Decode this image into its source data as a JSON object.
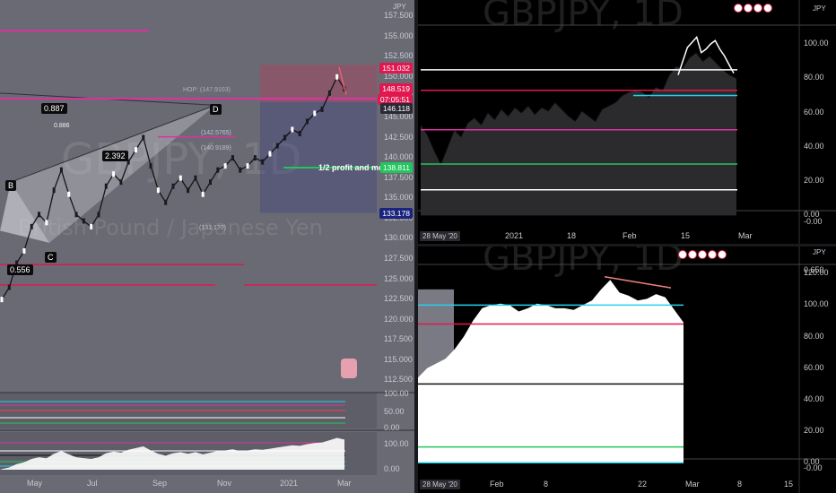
{
  "chart_data": [
    {
      "type": "line",
      "title": "GBPJPY, 1D",
      "subtitle": "British Pound / Japanese Yen",
      "currency_label": "JPY",
      "x_ticks": [
        "May",
        "Jul",
        "Sep",
        "Nov",
        "2021",
        "Mar"
      ],
      "y_ticks": [
        157.5,
        155.0,
        152.5,
        150.0,
        147.5,
        145.0,
        142.5,
        140.0,
        137.5,
        135.0,
        132.5,
        130.0,
        127.5,
        125.0,
        122.5,
        120.0,
        117.5,
        115.0,
        112.5
      ],
      "ylim": [
        111.0,
        159.5
      ],
      "price_tags": [
        {
          "value": 151.032,
          "label": "151.032",
          "color": "#e0184f"
        },
        {
          "value": 148.519,
          "label": "148.519",
          "color": "#e0184f"
        },
        {
          "value": 147.2,
          "label": "07:05:51",
          "color": "#e0184f"
        },
        {
          "value": 146.118,
          "label": "146.118",
          "color": "#2a2a36"
        },
        {
          "value": 138.811,
          "label": "138.811",
          "color": "#22c55e"
        },
        {
          "value": 133.178,
          "label": "133.178",
          "color": "#1a237e"
        }
      ],
      "annotations": {
        "hop": "HOP: (147.9103)",
        "label_0887": "0.887",
        "label_0886": "0.886",
        "label_2392": "2.392",
        "label_0556": "0.556",
        "label_b": "B",
        "label_c": "C",
        "label_d": "D",
        "profit": "1/2 profit and mo",
        "level_1425765": "(142.5765)",
        "level_1409189": "(140.9189)",
        "level_1311": "(131.1??)"
      },
      "series": [
        {
          "values": [
            122.5,
            124.0,
            127.0,
            128.5,
            131.5,
            133.0,
            132.0,
            136.0,
            138.5,
            135.5,
            133.0,
            132.2,
            131.5,
            133.0,
            136.5,
            138.0,
            137.0,
            139.5,
            141.0,
            142.5,
            139.0,
            136.0,
            134.5,
            136.5,
            137.5,
            136.0,
            137.5,
            135.5,
            137.0,
            138.5,
            139.0,
            140.0,
            138.5,
            139.0,
            140.0,
            139.5,
            140.5,
            141.5,
            142.5,
            143.5,
            143.0,
            144.5,
            145.5,
            146.0,
            148.0,
            150.0,
            148.5
          ]
        }
      ]
    },
    {
      "type": "area",
      "title": "GBPJPY, 1D",
      "currency_label": "JPY",
      "x_ticks": [
        "28 May '20",
        "2021",
        "18",
        "Feb",
        "15",
        "Mar"
      ],
      "y_ticks": [
        "100.00",
        "80.00",
        "60.00",
        "40.00",
        "20.00",
        "0.00",
        "-0.00"
      ],
      "ylim": [
        -5,
        110
      ],
      "levels": [
        85,
        70,
        50,
        30,
        15
      ],
      "series": [
        {
          "values": [
            53,
            47,
            38,
            30,
            40,
            50,
            46,
            54,
            57,
            53,
            60,
            56,
            62,
            58,
            63,
            60,
            64,
            59,
            63,
            61,
            66,
            62,
            58,
            55,
            61,
            58,
            55,
            62,
            64,
            66,
            70,
            72,
            73,
            72,
            69,
            75,
            73,
            82,
            87,
            86,
            92,
            95,
            90,
            93,
            89,
            85,
            82,
            80
          ]
        },
        {
          "values": [
            82,
            90,
            98,
            101,
            104,
            95,
            97,
            100,
            102,
            97,
            93,
            88,
            83
          ]
        }
      ]
    },
    {
      "type": "area",
      "title": "GBPJPY, 1D",
      "currency_label": "JPY",
      "x_ticks": [
        "28 May '20",
        "Feb",
        "8",
        "22",
        "Mar",
        "8",
        "15"
      ],
      "y_ticks": [
        "0.650",
        "120.00",
        "100.00",
        "80.00",
        "60.00",
        "40.00",
        "20.00",
        "0.00",
        "-0.00"
      ],
      "ylim": [
        -5,
        123
      ],
      "levels": [
        100,
        88,
        50,
        10,
        0
      ],
      "series": [
        {
          "values": [
            54,
            60,
            63,
            66,
            72,
            80,
            90,
            98,
            100,
            101,
            100,
            96,
            98,
            101,
            100,
            98,
            98,
            97,
            100,
            103,
            110,
            116,
            108,
            106,
            103,
            104,
            107,
            105,
            97,
            89
          ]
        }
      ]
    }
  ]
}
